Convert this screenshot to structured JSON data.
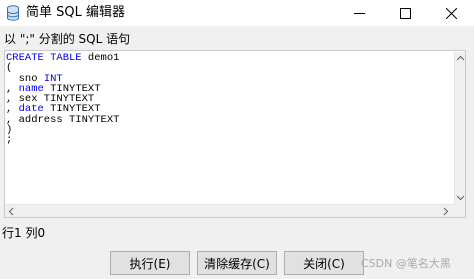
{
  "window": {
    "title": "简单 SQL 编辑器",
    "minimize_glyph": "—",
    "maximize_glyph": "☐",
    "close_glyph": "✕"
  },
  "instruction": "以 \";\" 分割的 SQL 语句",
  "editor": {
    "lines": [
      [
        {
          "text": "CREATE TABLE",
          "kw": true
        },
        {
          "text": " demo1",
          "kw": false
        }
      ],
      [
        {
          "text": "(",
          "kw": false
        }
      ],
      [
        {
          "text": "  sno ",
          "kw": false
        },
        {
          "text": "INT",
          "kw": true
        }
      ],
      [
        {
          "text": ", ",
          "kw": false
        },
        {
          "text": "name",
          "kw": true
        },
        {
          "text": " TINYTEXT",
          "kw": false
        }
      ],
      [
        {
          "text": ", sex TINYTEXT",
          "kw": false
        }
      ],
      [
        {
          "text": ", ",
          "kw": false
        },
        {
          "text": "date",
          "kw": true
        },
        {
          "text": " TINYTEXT",
          "kw": false
        }
      ],
      [
        {
          "text": ", address TINYTEXT",
          "kw": false
        }
      ],
      [
        {
          "text": ")",
          "kw": false
        }
      ],
      [
        {
          "text": ";",
          "kw": false
        }
      ]
    ]
  },
  "status": "行1 列0",
  "buttons": {
    "execute": "执行(E)",
    "clear_cache": "清除缓存(C)",
    "close": "关闭(C)"
  },
  "watermark": "CSDN @笔名大黑",
  "colors": {
    "keyword": "#0000ee",
    "background": "#f0f0f0",
    "editor_bg": "#ffffff"
  },
  "icons": {
    "app": "database-icon"
  }
}
